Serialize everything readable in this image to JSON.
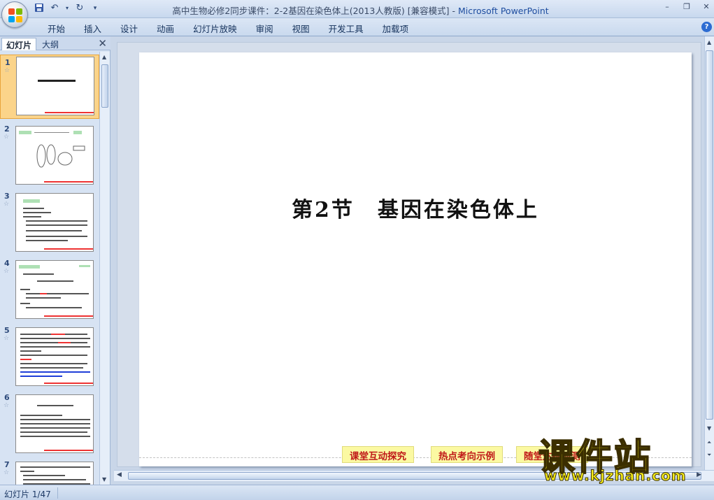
{
  "window": {
    "title": "高中生物必修2同步课件：2-2基因在染色体上(2013人教版) [兼容模式]",
    "title_sep": " - ",
    "app_name": "Microsoft PowerPoint"
  },
  "quick_access": [
    "save-icon",
    "undo-icon",
    "redo-icon",
    "customize-icon"
  ],
  "ribbon": {
    "tabs": [
      "开始",
      "插入",
      "设计",
      "动画",
      "幻灯片放映",
      "审阅",
      "视图",
      "开发工具",
      "加载项"
    ]
  },
  "left_panel": {
    "tab_slides": "幻灯片",
    "tab_outline": "大纲",
    "slide_numbers": [
      "1",
      "2",
      "3",
      "4",
      "5",
      "6",
      "7"
    ]
  },
  "slide": {
    "title": "第2节　基因在染色体上",
    "nav_buttons": [
      "课堂互动探究",
      "热点考向示例",
      "随堂达标检测"
    ]
  },
  "status": {
    "slide_indicator": "幻灯片 1/47"
  },
  "watermark": {
    "logo": "课件站",
    "url": "www.kjzhan.com"
  },
  "colors": {
    "accent_selected": "#fbd48a",
    "nav_button_bg": "#fbf9a2",
    "nav_button_text": "#c01818"
  }
}
